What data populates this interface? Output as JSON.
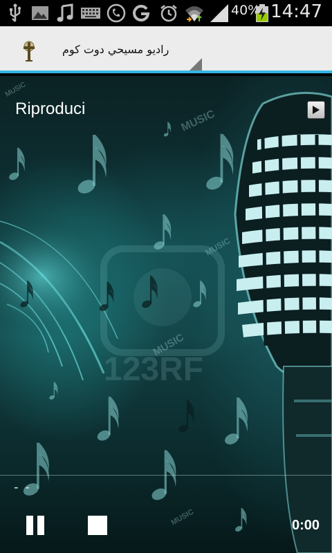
{
  "status_bar": {
    "battery_percent": "40%",
    "time": "14:47",
    "icons": [
      "usb-icon",
      "gallery-icon",
      "music-note-icon",
      "keyboard-icon",
      "phone-call-icon",
      "google-icon",
      "alarm-icon",
      "wifi-icon",
      "signal-icon",
      "battery-charging-icon"
    ]
  },
  "action_bar": {
    "station_name": "راديو مسيحي دوت كوم",
    "logo_icon": "cross-logo-icon",
    "accent_color": "#33b5e5"
  },
  "player": {
    "title_label": "Riproduci",
    "play_icon": "play-icon",
    "track_info": "- -",
    "elapsed_time": "0:00",
    "controls": [
      "pause-icon",
      "stop-icon"
    ],
    "background_words": [
      "MUSIC",
      "MUSIC",
      "MUSIC",
      "MUSIC",
      "123RF"
    ]
  }
}
